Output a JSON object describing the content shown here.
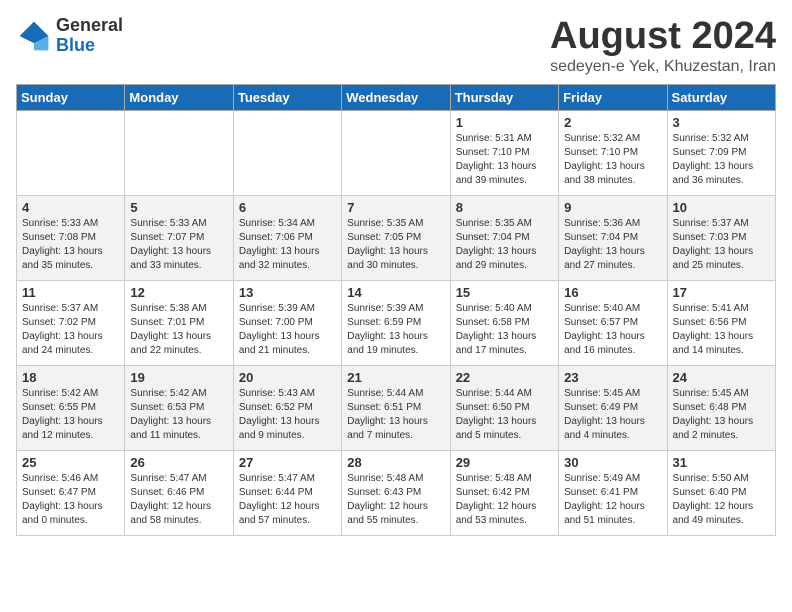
{
  "logo": {
    "general": "General",
    "blue": "Blue"
  },
  "title": "August 2024",
  "subtitle": "sedeyen-e Yek, Khuzestan, Iran",
  "weekdays": [
    "Sunday",
    "Monday",
    "Tuesday",
    "Wednesday",
    "Thursday",
    "Friday",
    "Saturday"
  ],
  "weeks": [
    [
      {
        "day": "",
        "info": ""
      },
      {
        "day": "",
        "info": ""
      },
      {
        "day": "",
        "info": ""
      },
      {
        "day": "",
        "info": ""
      },
      {
        "day": "1",
        "info": "Sunrise: 5:31 AM\nSunset: 7:10 PM\nDaylight: 13 hours\nand 39 minutes."
      },
      {
        "day": "2",
        "info": "Sunrise: 5:32 AM\nSunset: 7:10 PM\nDaylight: 13 hours\nand 38 minutes."
      },
      {
        "day": "3",
        "info": "Sunrise: 5:32 AM\nSunset: 7:09 PM\nDaylight: 13 hours\nand 36 minutes."
      }
    ],
    [
      {
        "day": "4",
        "info": "Sunrise: 5:33 AM\nSunset: 7:08 PM\nDaylight: 13 hours\nand 35 minutes."
      },
      {
        "day": "5",
        "info": "Sunrise: 5:33 AM\nSunset: 7:07 PM\nDaylight: 13 hours\nand 33 minutes."
      },
      {
        "day": "6",
        "info": "Sunrise: 5:34 AM\nSunset: 7:06 PM\nDaylight: 13 hours\nand 32 minutes."
      },
      {
        "day": "7",
        "info": "Sunrise: 5:35 AM\nSunset: 7:05 PM\nDaylight: 13 hours\nand 30 minutes."
      },
      {
        "day": "8",
        "info": "Sunrise: 5:35 AM\nSunset: 7:04 PM\nDaylight: 13 hours\nand 29 minutes."
      },
      {
        "day": "9",
        "info": "Sunrise: 5:36 AM\nSunset: 7:04 PM\nDaylight: 13 hours\nand 27 minutes."
      },
      {
        "day": "10",
        "info": "Sunrise: 5:37 AM\nSunset: 7:03 PM\nDaylight: 13 hours\nand 25 minutes."
      }
    ],
    [
      {
        "day": "11",
        "info": "Sunrise: 5:37 AM\nSunset: 7:02 PM\nDaylight: 13 hours\nand 24 minutes."
      },
      {
        "day": "12",
        "info": "Sunrise: 5:38 AM\nSunset: 7:01 PM\nDaylight: 13 hours\nand 22 minutes."
      },
      {
        "day": "13",
        "info": "Sunrise: 5:39 AM\nSunset: 7:00 PM\nDaylight: 13 hours\nand 21 minutes."
      },
      {
        "day": "14",
        "info": "Sunrise: 5:39 AM\nSunset: 6:59 PM\nDaylight: 13 hours\nand 19 minutes."
      },
      {
        "day": "15",
        "info": "Sunrise: 5:40 AM\nSunset: 6:58 PM\nDaylight: 13 hours\nand 17 minutes."
      },
      {
        "day": "16",
        "info": "Sunrise: 5:40 AM\nSunset: 6:57 PM\nDaylight: 13 hours\nand 16 minutes."
      },
      {
        "day": "17",
        "info": "Sunrise: 5:41 AM\nSunset: 6:56 PM\nDaylight: 13 hours\nand 14 minutes."
      }
    ],
    [
      {
        "day": "18",
        "info": "Sunrise: 5:42 AM\nSunset: 6:55 PM\nDaylight: 13 hours\nand 12 minutes."
      },
      {
        "day": "19",
        "info": "Sunrise: 5:42 AM\nSunset: 6:53 PM\nDaylight: 13 hours\nand 11 minutes."
      },
      {
        "day": "20",
        "info": "Sunrise: 5:43 AM\nSunset: 6:52 PM\nDaylight: 13 hours\nand 9 minutes."
      },
      {
        "day": "21",
        "info": "Sunrise: 5:44 AM\nSunset: 6:51 PM\nDaylight: 13 hours\nand 7 minutes."
      },
      {
        "day": "22",
        "info": "Sunrise: 5:44 AM\nSunset: 6:50 PM\nDaylight: 13 hours\nand 5 minutes."
      },
      {
        "day": "23",
        "info": "Sunrise: 5:45 AM\nSunset: 6:49 PM\nDaylight: 13 hours\nand 4 minutes."
      },
      {
        "day": "24",
        "info": "Sunrise: 5:45 AM\nSunset: 6:48 PM\nDaylight: 13 hours\nand 2 minutes."
      }
    ],
    [
      {
        "day": "25",
        "info": "Sunrise: 5:46 AM\nSunset: 6:47 PM\nDaylight: 13 hours\nand 0 minutes."
      },
      {
        "day": "26",
        "info": "Sunrise: 5:47 AM\nSunset: 6:46 PM\nDaylight: 12 hours\nand 58 minutes."
      },
      {
        "day": "27",
        "info": "Sunrise: 5:47 AM\nSunset: 6:44 PM\nDaylight: 12 hours\nand 57 minutes."
      },
      {
        "day": "28",
        "info": "Sunrise: 5:48 AM\nSunset: 6:43 PM\nDaylight: 12 hours\nand 55 minutes."
      },
      {
        "day": "29",
        "info": "Sunrise: 5:48 AM\nSunset: 6:42 PM\nDaylight: 12 hours\nand 53 minutes."
      },
      {
        "day": "30",
        "info": "Sunrise: 5:49 AM\nSunset: 6:41 PM\nDaylight: 12 hours\nand 51 minutes."
      },
      {
        "day": "31",
        "info": "Sunrise: 5:50 AM\nSunset: 6:40 PM\nDaylight: 12 hours\nand 49 minutes."
      }
    ]
  ]
}
